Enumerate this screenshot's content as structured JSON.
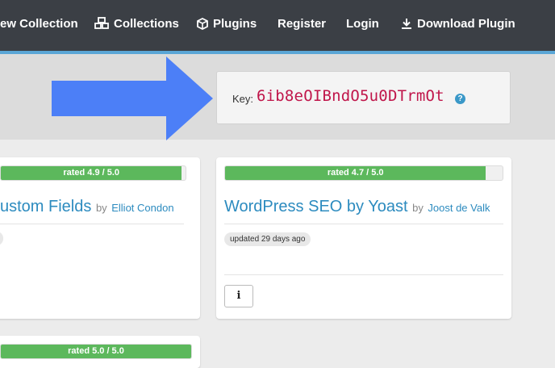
{
  "nav": {
    "items": [
      {
        "label": "ew Collection",
        "icon": "none"
      },
      {
        "label": "Collections",
        "icon": "cubes-icon"
      },
      {
        "label": "Plugins",
        "icon": "cube-icon"
      },
      {
        "label": "Register",
        "icon": "none"
      },
      {
        "label": "Login",
        "icon": "none"
      },
      {
        "label": "Download Plugin",
        "icon": "download-icon"
      }
    ],
    "colors": {
      "background": "#3b3f45",
      "accent": "#5aa6d6"
    }
  },
  "key_panel": {
    "label": "Key:",
    "value": "6ib8eOIBndO5u0DTrmOt",
    "help_glyph": "?",
    "arrow_color": "#4c7ff7"
  },
  "cards": [
    {
      "rating_text": "rated 4.9 / 5.0",
      "rating_value": 4.9,
      "title": "ustom Fields",
      "by": "by",
      "author": "Elliot Condon"
    },
    {
      "rating_text": "rated 4.7 / 5.0",
      "rating_value": 4.7,
      "title": "WordPress SEO by Yoast",
      "by": "by",
      "author": "Joost de Valk",
      "updated": "updated 29 days ago",
      "info_glyph": "i"
    },
    {
      "rating_text": "rated 5.0 / 5.0",
      "rating_value": 5.0
    }
  ],
  "colors": {
    "rating_fill": "#5cb85c",
    "link": "#2c8bbf",
    "key_text": "#c0154a"
  }
}
